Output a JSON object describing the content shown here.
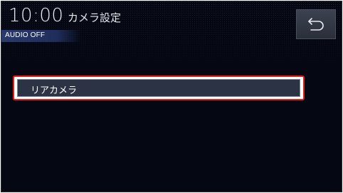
{
  "header": {
    "clock": "10:00",
    "title": "カメラ設定",
    "audio_status": "AUDIO OFF",
    "back_icon": "back-arrow-icon"
  },
  "menu": {
    "items": [
      {
        "label": "リアカメラ"
      }
    ]
  },
  "colors": {
    "background": "#050812",
    "highlight": "#e31b1b",
    "item_bg": "#2c3345",
    "audio_bar": "#2a3a6e"
  }
}
